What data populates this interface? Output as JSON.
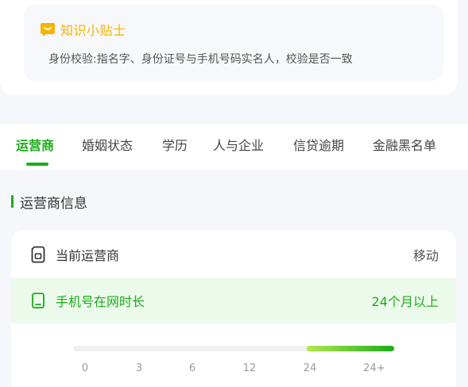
{
  "tip": {
    "title": "知识小贴士",
    "text": "身份校验:指名字、身份证号与手机号码实名人，校验是否一致",
    "icon": "message-icon",
    "color": "#f5b400"
  },
  "tabs": [
    {
      "label": "运营商",
      "active": true
    },
    {
      "label": "婚姻状态",
      "active": false
    },
    {
      "label": "学历",
      "active": false
    },
    {
      "label": "人与企业",
      "active": false
    },
    {
      "label": "信贷逾期",
      "active": false
    },
    {
      "label": "金融黑名单",
      "active": false
    }
  ],
  "section": {
    "title": "运营商信息"
  },
  "carrier": {
    "label": "当前运营商",
    "value": "移动",
    "icon": "sim-card-icon"
  },
  "tenure": {
    "label": "手机号在网时长",
    "value": "24个月以上",
    "icon": "phone-icon",
    "ticks": [
      "0",
      "3",
      "6",
      "12",
      "24",
      "24+"
    ],
    "fill_from_index": 4,
    "fill_to_index": 5
  },
  "colors": {
    "accent": "#1aad19",
    "highlight_bg": "#ecfaec",
    "tip": "#f5b400"
  }
}
